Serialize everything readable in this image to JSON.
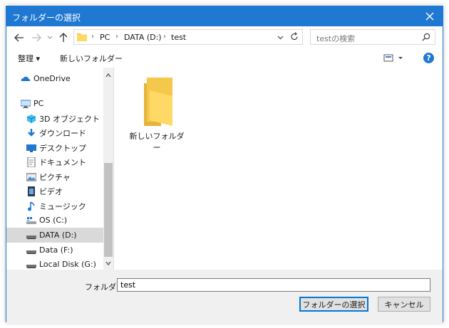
{
  "window": {
    "title": "フォルダーの選択"
  },
  "address": {
    "crumbs": [
      "PC",
      "DATA (D:)",
      "test"
    ]
  },
  "search": {
    "placeholder": "testの検索"
  },
  "toolbar": {
    "organize": "整理 ▾",
    "new_folder": "新しいフォルダー",
    "help": "?"
  },
  "sidebar": {
    "items": [
      {
        "label": "OneDrive",
        "icon": "onedrive-icon"
      },
      {
        "label": "PC",
        "icon": "pc-icon"
      },
      {
        "label": "3D オブジェクト",
        "icon": "3d-objects-icon"
      },
      {
        "label": "ダウンロード",
        "icon": "download-icon"
      },
      {
        "label": "デスクトップ",
        "icon": "desktop-icon"
      },
      {
        "label": "ドキュメント",
        "icon": "documents-icon"
      },
      {
        "label": "ピクチャ",
        "icon": "pictures-icon"
      },
      {
        "label": "ビデオ",
        "icon": "video-icon"
      },
      {
        "label": "ミュージック",
        "icon": "music-icon"
      },
      {
        "label": "OS (C:)",
        "icon": "drive-icon"
      },
      {
        "label": "DATA (D:)",
        "icon": "drive-icon",
        "selected": true
      },
      {
        "label": "Data (F:)",
        "icon": "drive-icon"
      },
      {
        "label": "Local Disk (G:)",
        "icon": "drive-icon"
      }
    ]
  },
  "files": [
    {
      "name": "新しいフォルダー"
    }
  ],
  "bottom": {
    "folder_label": "フォルダー:",
    "folder_value": "test",
    "select_button": "フォルダーの選択",
    "cancel_button": "キャンセル"
  },
  "colors": {
    "accent": "#1f78d1",
    "folder": "#f5c84c",
    "selected": "#d9d9d9"
  }
}
